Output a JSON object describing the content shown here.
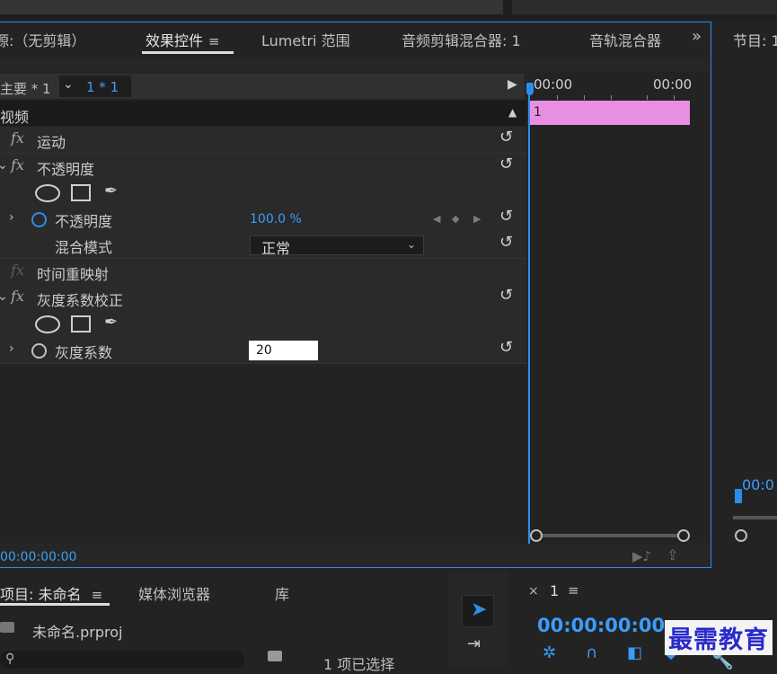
{
  "tabs": {
    "source": "源:（无剪辑）",
    "effect_controls": "效果控件",
    "menu_glyph": "≡",
    "lumetri": "Lumetri 范围",
    "audio_clip_mixer": "音频剪辑混合器: 1",
    "audio_track_mixer": "音轨混合器",
    "overflow": "»",
    "program": "节目: 1"
  },
  "effect_controls": {
    "master_label": "主要 * 1",
    "clip_label": "1 * 1",
    "chevron": "⌄",
    "play_glyph": "▶",
    "video_header": "视频",
    "collapse_glyph": "▲",
    "rows": {
      "motion": "运动",
      "opacity_group": "不透明度",
      "opacity_param": "不透明度",
      "opacity_value": "100.0 %",
      "blend_mode_label": "混合模式",
      "blend_mode_value": "正常",
      "time_remap": "时间重映射",
      "gamma_group": "灰度系数校正",
      "gamma_param": "灰度系数",
      "gamma_value": "20"
    },
    "fx_glyph": "fx",
    "reset_glyph": "↺",
    "pen_glyph": "✒",
    "twisty_right": "›",
    "twisty_down": "⌄",
    "kf_prev": "◀",
    "kf_add": "◆",
    "kf_next": "▶",
    "timecode": "00:00:00:00",
    "footer_icon_1": "▶♪",
    "footer_icon_2": "⇪"
  },
  "mini_timeline": {
    "time_start": "00:00",
    "time_end": "00:00",
    "clip_label": "1"
  },
  "program": {
    "timecode": "00:0"
  },
  "project": {
    "tab_project": "项目: 未命名",
    "menu_glyph": "≡",
    "tab_media_browser": "媒体浏览器",
    "tab_library": "库",
    "file_name": "未命名.prproj",
    "search_glyph": "⚲",
    "selection_status": "1 项已选择"
  },
  "tools": {
    "selection_glyph": "➤",
    "track_select_glyph": "⇥"
  },
  "timeline": {
    "close_glyph": "×",
    "sequence_name": "1",
    "menu_glyph": "≡",
    "timecode": "00:00:00:00",
    "icon_snap": "✲",
    "icon_magnet": "∩",
    "icon_linked": "◧",
    "icon_marker": "◆",
    "icon_wrench": "🔧"
  },
  "watermark": "最需教育",
  "colors": {
    "accent_blue": "#2d8ceb",
    "link_blue": "#3a9dfa",
    "clip_pink": "#e88fe4"
  }
}
